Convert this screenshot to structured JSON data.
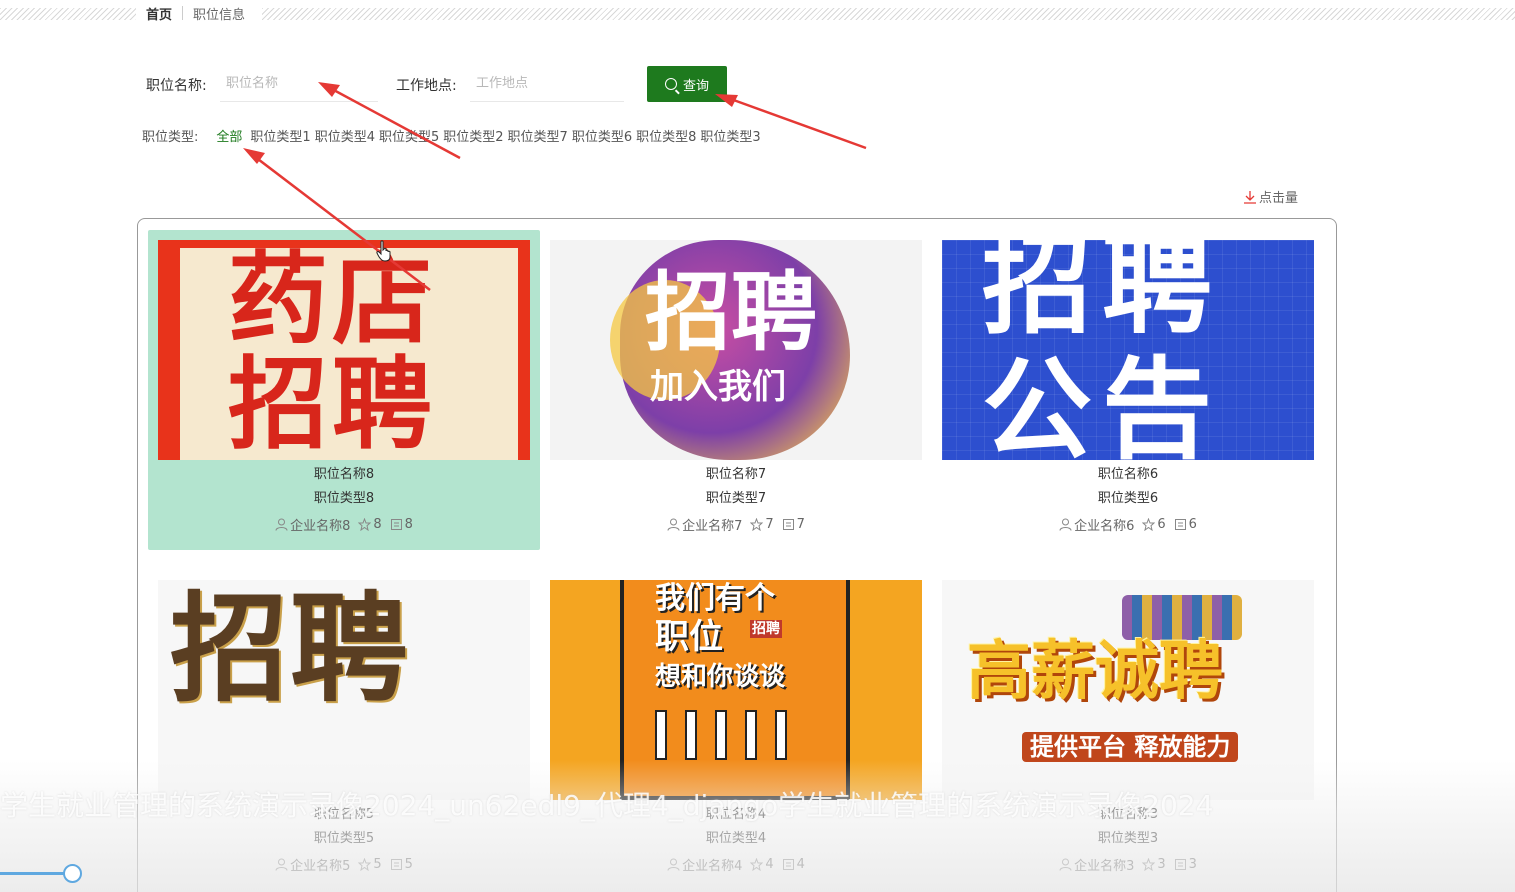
{
  "breadcrumb": {
    "home": "首页",
    "current": "职位信息"
  },
  "search": {
    "name_label": "职位名称:",
    "name_placeholder": "职位名称",
    "location_label": "工作地点:",
    "location_placeholder": "工作地点",
    "button_label": "查询"
  },
  "types": {
    "label": "职位类型:",
    "items": [
      "全部",
      "职位类型1",
      "职位类型4",
      "职位类型5",
      "职位类型2",
      "职位类型7",
      "职位类型6",
      "职位类型8",
      "职位类型3"
    ],
    "active_index": 0
  },
  "sort": {
    "label": "点击量"
  },
  "cards": [
    {
      "name": "职位名称8",
      "type": "职位类型8",
      "company": "企业名称8",
      "stars": "8",
      "views": "8",
      "poster": [
        "药店",
        "招聘"
      ]
    },
    {
      "name": "职位名称7",
      "type": "职位类型7",
      "company": "企业名称7",
      "stars": "7",
      "views": "7",
      "poster": [
        "招聘",
        "加入我们"
      ]
    },
    {
      "name": "职位名称6",
      "type": "职位类型6",
      "company": "企业名称6",
      "stars": "6",
      "views": "6",
      "poster": [
        "招聘",
        "公告"
      ]
    },
    {
      "name": "职位名称5",
      "type": "职位类型5",
      "company": "企业名称5",
      "stars": "5",
      "views": "5",
      "poster": [
        "招聘"
      ]
    },
    {
      "name": "职位名称4",
      "type": "职位类型4",
      "company": "企业名称4",
      "stars": "4",
      "views": "4",
      "poster": [
        "我们有个",
        "职位",
        "想和你谈谈",
        "招聘"
      ]
    },
    {
      "name": "职位名称3",
      "type": "职位类型3",
      "company": "企业名称3",
      "stars": "3",
      "views": "3",
      "poster": [
        "高薪诚聘",
        "提供平台 释放能力"
      ]
    }
  ],
  "video": {
    "caption": "学生就业管理的系统演示录像2024_un62edl9_代理4_django学生就业管理的系统演示录像2024",
    "progress": 0.05
  },
  "colors": {
    "accent": "#1e7a1e",
    "hover_card": "#b3e4cf",
    "arrow": "#e53935"
  }
}
